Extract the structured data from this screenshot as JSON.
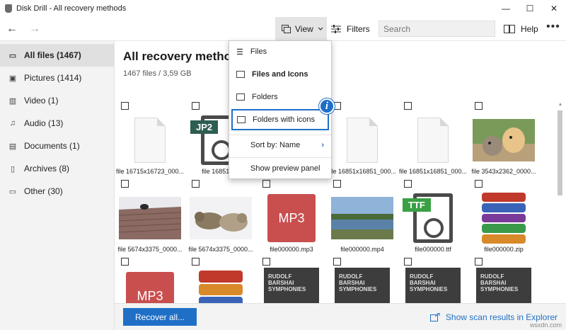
{
  "window": {
    "title": "Disk Drill - All recovery methods",
    "minimize": "—",
    "maximize": "☐",
    "close": "✕"
  },
  "toolbar": {
    "back": "←",
    "forward": "→",
    "view_label": "View",
    "filters_label": "Filters",
    "search_placeholder": "Search",
    "help_label": "Help",
    "more": "•••"
  },
  "sidebar": {
    "items": [
      {
        "label": "All files (1467)",
        "icon": "folder-icon"
      },
      {
        "label": "Pictures (1414)",
        "icon": "picture-icon"
      },
      {
        "label": "Video (1)",
        "icon": "video-icon"
      },
      {
        "label": "Audio (13)",
        "icon": "music-icon"
      },
      {
        "label": "Documents (1)",
        "icon": "document-icon"
      },
      {
        "label": "Archives (8)",
        "icon": "archive-icon"
      },
      {
        "label": "Other (30)",
        "icon": "folder-icon"
      }
    ]
  },
  "main": {
    "title": "All recovery methods",
    "subtitle": "1467 files / 3,59 GB",
    "files": [
      {
        "name": "file 16715x16723_000...",
        "kind": "doc"
      },
      {
        "name": "file 16851x16",
        "kind": "jp2",
        "tag": "JP2"
      },
      {
        "name": "",
        "kind": "hidden"
      },
      {
        "name": "file 16851x16851_000...",
        "kind": "doc"
      },
      {
        "name": "file 16851x16851_000...",
        "kind": "doc"
      },
      {
        "name": "file 3543x2362_0000...",
        "kind": "photo-puppy"
      },
      {
        "name": "file 5674x3375_0000...",
        "kind": "photo-roof"
      },
      {
        "name": "file 5674x3375_0000...",
        "kind": "photo-cats"
      },
      {
        "name": "file000000.mp3",
        "kind": "mp3",
        "tag": "MP3"
      },
      {
        "name": "file000000.mp4",
        "kind": "photo-lake"
      },
      {
        "name": "file000000.ttf",
        "kind": "ttf",
        "tag": "TTF"
      },
      {
        "name": "file000000.zip",
        "kind": "zip"
      },
      {
        "name": "",
        "kind": "mp3",
        "tag": "MP3"
      },
      {
        "name": "",
        "kind": "zip"
      },
      {
        "name": "",
        "kind": "book",
        "tag": "RUDOLF BARSHAI SYMPHONIES"
      },
      {
        "name": "",
        "kind": "book",
        "tag": "RUDOLF BARSHAI SYMPHONIES"
      },
      {
        "name": "",
        "kind": "book",
        "tag": "RUDOLF BARSHAI SYMPHONIES"
      },
      {
        "name": "",
        "kind": "book",
        "tag": "RUDOLF BARSHAI SYMPHONIES"
      }
    ]
  },
  "bottom": {
    "recover_label": "Recover all...",
    "scan_link": "Show scan results in Explorer"
  },
  "view_menu": {
    "items": [
      {
        "label": "Files"
      },
      {
        "label": "Files and Icons"
      },
      {
        "label": "Folders"
      },
      {
        "label": "Folders with icons"
      },
      {
        "label": "Sort by: Name"
      },
      {
        "label": "Show preview panel"
      }
    ],
    "info_badge": "i"
  },
  "watermark": "wsxdn.com",
  "colors": {
    "accent": "#1f6fc7",
    "mp3": "#c94f4f",
    "ttf_tag": "#3aa043",
    "jp2_tag": "#2e5d52"
  }
}
